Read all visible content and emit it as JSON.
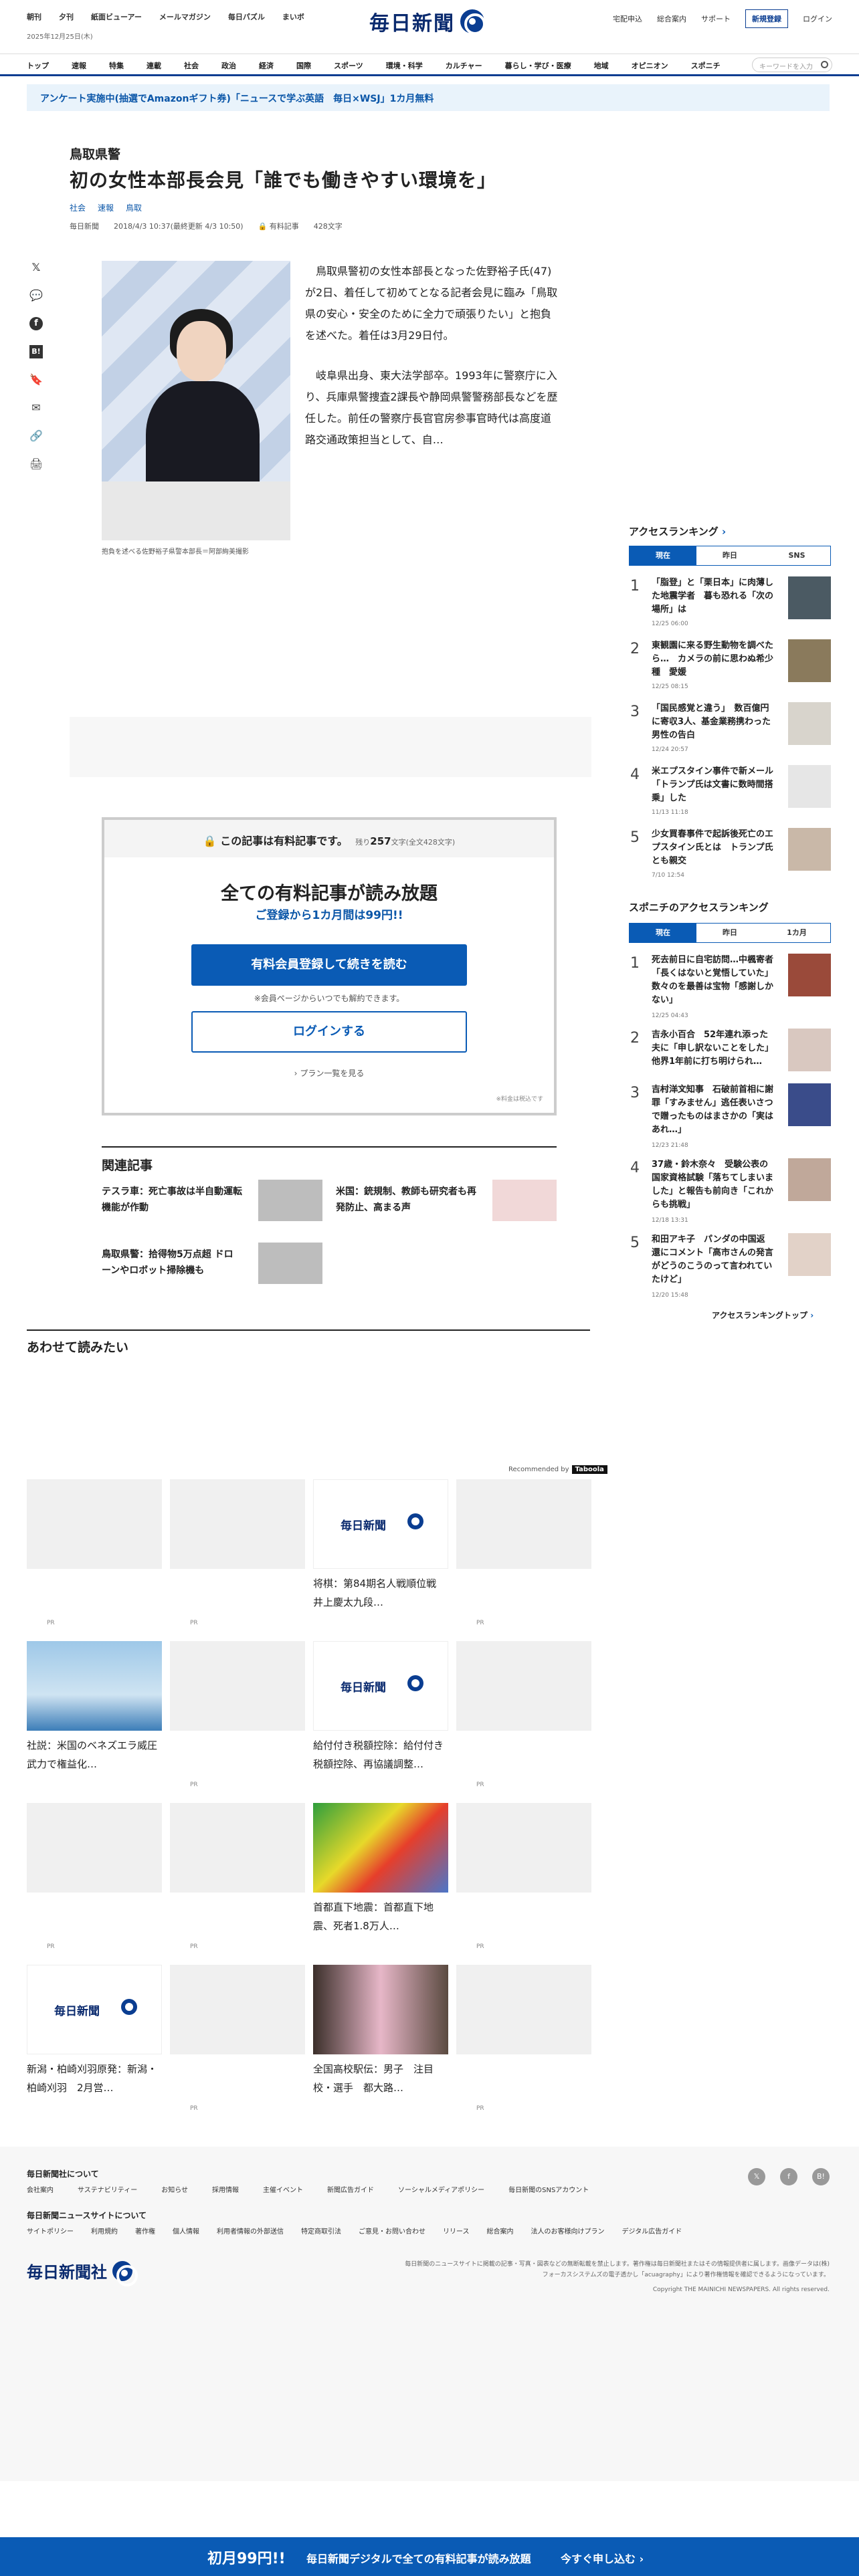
{
  "header": {
    "util_left": [
      "朝刊",
      "夕刊",
      "紙面ビューアー",
      "メールマガジン",
      "毎日パズル",
      "まいボ"
    ],
    "date": "2025年12月25日(木)",
    "logo": "毎日新聞",
    "util_right": [
      "宅配申込",
      "総合案内",
      "サポート"
    ],
    "register": "新規登録",
    "login": "ログイン"
  },
  "nav": {
    "items": [
      "トップ",
      "速報",
      "特集",
      "連載",
      "社会",
      "政治",
      "経済",
      "国際",
      "スポーツ",
      "環境・科学",
      "カルチャー",
      "暮らし・学び・医療",
      "地域",
      "オピニオン",
      "スポニチ"
    ],
    "search_placeholder": "キーワードを入力"
  },
  "promo": "アンケート実施中(抽選でAmazonギフト券)「ニュースで学ぶ英語　毎日×WSJ」1カ月無料",
  "article": {
    "kicker": "鳥取県警",
    "headline": "初の女性本部長会見「誰でも働きやすい環境を」",
    "tags": [
      "社会",
      "速報",
      "鳥取"
    ],
    "source": "毎日新聞",
    "datetime": "2018/4/3 10:37(最終更新 4/3 10:50)",
    "paid_label": "有料記事",
    "char_count": "428文字",
    "caption": "抱負を述べる佐野裕子県警本部長＝阿部絢美撮影",
    "paragraphs": [
      "鳥取県警初の女性本部長となった佐野裕子氏(47)が2日、着任して初めてとなる記者会見に臨み「鳥取県の安心・安全のために全力で頑張りたい」と抱負を述べた。着任は3月29日付。",
      "岐阜県出身、東大法学部卒。1993年に警察庁に入り、兵庫県警捜査2課長や静岡県警警務部長などを歴任した。前任の警察庁長官官房参事官時代は高度道路交通政策担当として、自…"
    ]
  },
  "paywall": {
    "top": "この記事は有料記事です。",
    "remaining_prefix": "残り",
    "remaining": "257",
    "remaining_suffix": "文字(全文428文字)",
    "title": "全ての有料記事が読み放題",
    "sub": "ご登録から1カ月間は99円!!",
    "btn_register": "有料会員登録して続きを読む",
    "note": "※会員ページからいつでも解約できます。",
    "btn_login": "ログインする",
    "plans": "プラン一覧を見る",
    "tax": "※料金は税込です"
  },
  "related": {
    "title": "関連記事",
    "items": [
      {
        "title": "テスラ車：死亡事故は半自動運転機能が作動"
      },
      {
        "title": "米国：銃規制、教師も研究者も再発防止、高まる声"
      },
      {
        "title": "鳥取県警：拾得物5万点超 ドローンやロボット掃除機も"
      }
    ]
  },
  "together": {
    "title": "あわせて読みたい",
    "recommended": "Recommended by",
    "recommended_brand": "Taboola",
    "pr": "PR",
    "cards": [
      "将棋：第84期名人戦順位戦　井上慶太九段…",
      "社説：米国のベネズエラ威圧　武力で権益化…",
      "給付付き税額控除：給付付き税額控除、再協議調整…",
      "首都直下地震：首都直下地震、死者1.8万人…",
      "新潟・柏崎刈羽原発：新潟・柏崎刈羽　2月営…",
      "全国高校駅伝：男子　注目校・選手　都大路…"
    ]
  },
  "sidebar": {
    "ranking_title": "アクセスランキング",
    "tabs": [
      "現在",
      "昨日",
      "SNS"
    ],
    "items": [
      {
        "rank": "1",
        "title": "「脂登」と「栗日本」に肉薄した地震学者　暮も恐れる「次の場所」は",
        "date": "12/25 06:00"
      },
      {
        "rank": "2",
        "title": "東観園に来る野生動物を調べたら…　カメラの前に思わぬ希少種　愛媛",
        "date": "12/25 08:15"
      },
      {
        "rank": "3",
        "title": "「国民感覚と違う」　数百億円に寄収3人、基金業務携わった男性の告白",
        "date": "12/24 20:57"
      },
      {
        "rank": "4",
        "title": "米エプスタイン事件で新メール「トランプ氏は文書に数時間搭乗」した",
        "date": "11/13 11:18"
      },
      {
        "rank": "5",
        "title": "少女買春事件で起訴後死亡のエプスタイン氏とは　トランプ氏とも親交",
        "date": "7/10 12:54"
      }
    ],
    "sponichi_title": "スポニチのアクセスランキング",
    "sponichi_tabs": [
      "現在",
      "昨日",
      "1カ月"
    ],
    "sponichi_items": [
      {
        "rank": "1",
        "title": "死去前日に自宅訪問…中楓寄者「長くはないと覚悟していた」数々のを最善は宝物「感謝しかない」",
        "date": "12/25 04:43"
      },
      {
        "rank": "2",
        "title": "吉永小百合　52年連れ添った夫に「申し訳ないことをした」他界1年前に打ち明けられ…",
        "date": "12/22 15:57"
      },
      {
        "rank": "3",
        "title": "吉村洋文知事　石破前首相に謝罪「すみません」逃任表いさつで贈ったものはまさかの「実はあれ…」",
        "date": "12/23 21:48"
      },
      {
        "rank": "4",
        "title": "37歳・鈴木奈々　受験公表の国家資格試験「落ちてしまいました」と報告も前向き「これからも挑戦」",
        "date": "12/18 13:31"
      },
      {
        "rank": "5",
        "title": "和田アキ子　パンダの中国返還にコメント「高市さんの発言がどうのこうのって言われていたけど」",
        "date": "12/20 15:48"
      }
    ],
    "more": "アクセスランキングトップ"
  },
  "footer": {
    "about_title": "毎日新聞社について",
    "about_links": [
      "会社案内",
      "サステナビリティー",
      "お知らせ",
      "採用情報",
      "主催イベント",
      "新聞広告ガイド",
      "ソーシャルメディアポリシー",
      "毎日新聞のSNSアカウント"
    ],
    "site_title": "毎日新聞ニュースサイトについて",
    "site_links": [
      "サイトポリシー",
      "利用規約",
      "著作権",
      "個人情報",
      "利用者情報の外部送信",
      "特定商取引法",
      "ご意見・お問い合わせ",
      "リリース",
      "総合案内",
      "法人のお客様向けプラン",
      "デジタル広告ガイド"
    ],
    "logo": "毎日新聞社",
    "notice": "毎日新聞のニュースサイトに掲載の記事・写真・図表などの無断転載を禁止します。著作権は毎日新聞社またはその情報提供者に属します。画像データは(株)フォーカスシステムズの電子透かし「acuagraphy」により著作権情報を確認できるようになっています。",
    "copyright": "Copyright THE MAINICHI NEWSPAPERS. All rights reserved."
  },
  "banner": {
    "price": "初月99円!!",
    "text": "毎日新聞デジタルで全ての有料記事が読み放題",
    "cta": "今すぐ申し込む"
  },
  "colors": {
    "brand": "#0a3d91",
    "accent": "#0a5bb5",
    "link": "#0a56a8"
  }
}
